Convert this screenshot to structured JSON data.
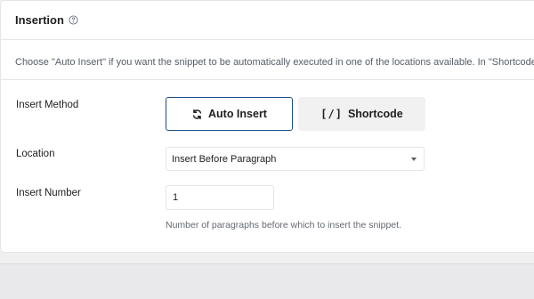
{
  "section": {
    "title": "Insertion",
    "description": "Choose \"Auto Insert\" if you want the snippet to be automatically executed in one of the locations available. In \"Shortcode\" mode, the snip"
  },
  "insert_method": {
    "label": "Insert Method",
    "options": [
      {
        "label": "Auto Insert",
        "icon": "refresh-icon",
        "selected": true
      },
      {
        "label": "Shortcode",
        "icon": "shortcode-brackets-icon",
        "glyph": "[/]",
        "selected": false
      }
    ]
  },
  "location": {
    "label": "Location",
    "value": "Insert Before Paragraph"
  },
  "insert_number": {
    "label": "Insert Number",
    "value": "1",
    "help": "Number of paragraphs before which to insert the snippet."
  },
  "colors": {
    "accent": "#1d4e89",
    "border": "#e2e4e7",
    "muted_text": "#646970"
  }
}
